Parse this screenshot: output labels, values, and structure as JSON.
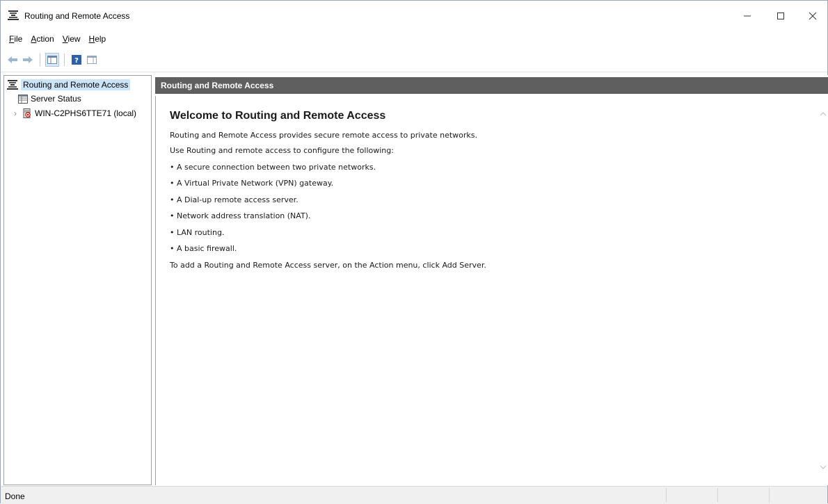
{
  "window": {
    "title": "Routing and Remote Access",
    "controls": {
      "minimize": "–",
      "maximize": "☐",
      "close": "✕"
    }
  },
  "menu": [
    {
      "label": "File",
      "mnemonic": "F",
      "rest": "ile"
    },
    {
      "label": "Action",
      "mnemonic": "A",
      "rest": "ction"
    },
    {
      "label": "View",
      "mnemonic": "V",
      "rest": "iew"
    },
    {
      "label": "Help",
      "mnemonic": "H",
      "rest": "elp"
    }
  ],
  "toolbar": {
    "icons": [
      "back-arrow-icon",
      "forward-arrow-icon",
      "show-hide-console-tree-icon",
      "help-icon",
      "properties-pane-icon"
    ]
  },
  "tree": {
    "root": "Routing and Remote Access",
    "items": [
      {
        "label": "Server Status",
        "icon": "server-status-icon"
      },
      {
        "label": "WIN-C2PHS6TTE71 (local)",
        "icon": "server-icon",
        "expander": "›"
      }
    ]
  },
  "detail": {
    "header": "Routing and Remote Access",
    "title": "Welcome to Routing and Remote Access",
    "lines": [
      "Routing and Remote Access provides secure remote access to private networks.",
      "Use Routing and remote access to configure the following:",
      "• A secure connection between two private networks.",
      "• A Virtual Private Network (VPN) gateway.",
      "• A Dial-up remote access server.",
      "• Network address translation (NAT).",
      "• LAN routing.",
      "• A basic firewall.",
      "To add a Routing and Remote Access server, on the Action menu, click Add Server."
    ]
  },
  "statusbar": {
    "text": "Done"
  },
  "colors": {
    "header_bg": "#5f5f5f",
    "selection": "#cce4f7",
    "accent": "#1e72c8"
  }
}
